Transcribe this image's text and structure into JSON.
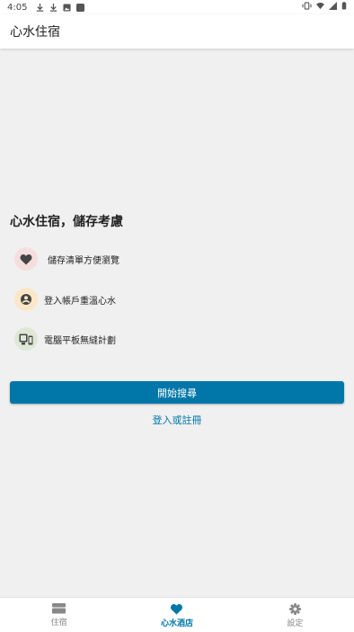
{
  "status_bar": {
    "time": "4:05",
    "left_icons": [
      "download-icon",
      "download-icon",
      "image-icon",
      "app-icon"
    ],
    "right_icons": [
      "vibrate-icon",
      "wifi-icon",
      "signal-icon",
      "battery-icon"
    ]
  },
  "app_bar": {
    "title": "心水住宿"
  },
  "main": {
    "headline": "心水住宿，儲存考慮",
    "features": [
      {
        "icon": "heart-icon",
        "label": "儲存清單方便瀏覽",
        "icon_bg": "#f5dede",
        "icon_color": "#444444"
      },
      {
        "icon": "account-icon",
        "label": "登入帳戶重溫心水",
        "icon_bg": "#fbe6c8",
        "icon_color": "#444444"
      },
      {
        "icon": "devices-icon",
        "label": "電腦平板無縫計劃",
        "icon_bg": "#dfe8d6",
        "icon_color": "#444444"
      }
    ],
    "start_button": "開始搜尋",
    "login_link": "登入或註冊"
  },
  "bottom_nav": {
    "items": [
      {
        "icon": "bed-icon",
        "label": "住宿",
        "active": false
      },
      {
        "icon": "heart-icon",
        "label": "心水酒店",
        "active": true
      },
      {
        "icon": "gear-icon",
        "label": "設定",
        "active": false
      }
    ]
  },
  "colors": {
    "accent": "#0077a8",
    "background": "#f0f0f0",
    "surface": "#ffffff"
  }
}
